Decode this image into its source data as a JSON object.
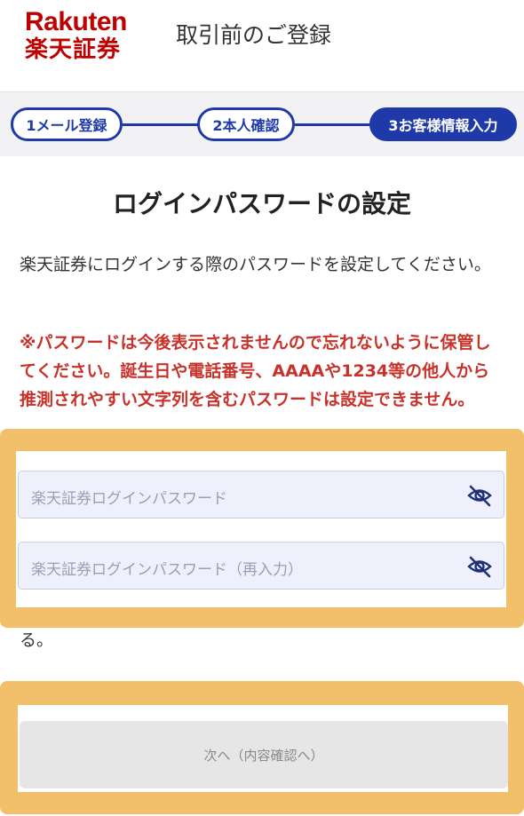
{
  "header": {
    "logo_en": "Rakuten",
    "logo_jp": "楽天証券",
    "title": "取引前のご登録"
  },
  "stepper": {
    "steps": [
      {
        "label": "1メール登録",
        "state": "done"
      },
      {
        "label": "2本人確認",
        "state": "done"
      },
      {
        "label": "3お客様情報入力",
        "state": "current"
      }
    ]
  },
  "main": {
    "title": "ログインパスワードの設定",
    "description": "楽天証券にログインする際のパスワードを設定してください。",
    "warning": "※パスワードは今後表示されませんので忘れないように保管してください。誕生日や電話番号、AAAAや1234等の他人から推測されやすい文字列を含むパスワードは設定できません。",
    "password_placeholder": "楽天証券ログインパスワード",
    "password_confirm_placeholder": "楽天証券ログインパスワード（再入力）",
    "trailing_text": "る。",
    "next_button": "次へ（内容確認へ）"
  },
  "colors": {
    "brand_red": "#bf0000",
    "step_blue": "#1f3aa8",
    "warning_red": "#c8322a",
    "highlight": "#f2bf6a"
  }
}
